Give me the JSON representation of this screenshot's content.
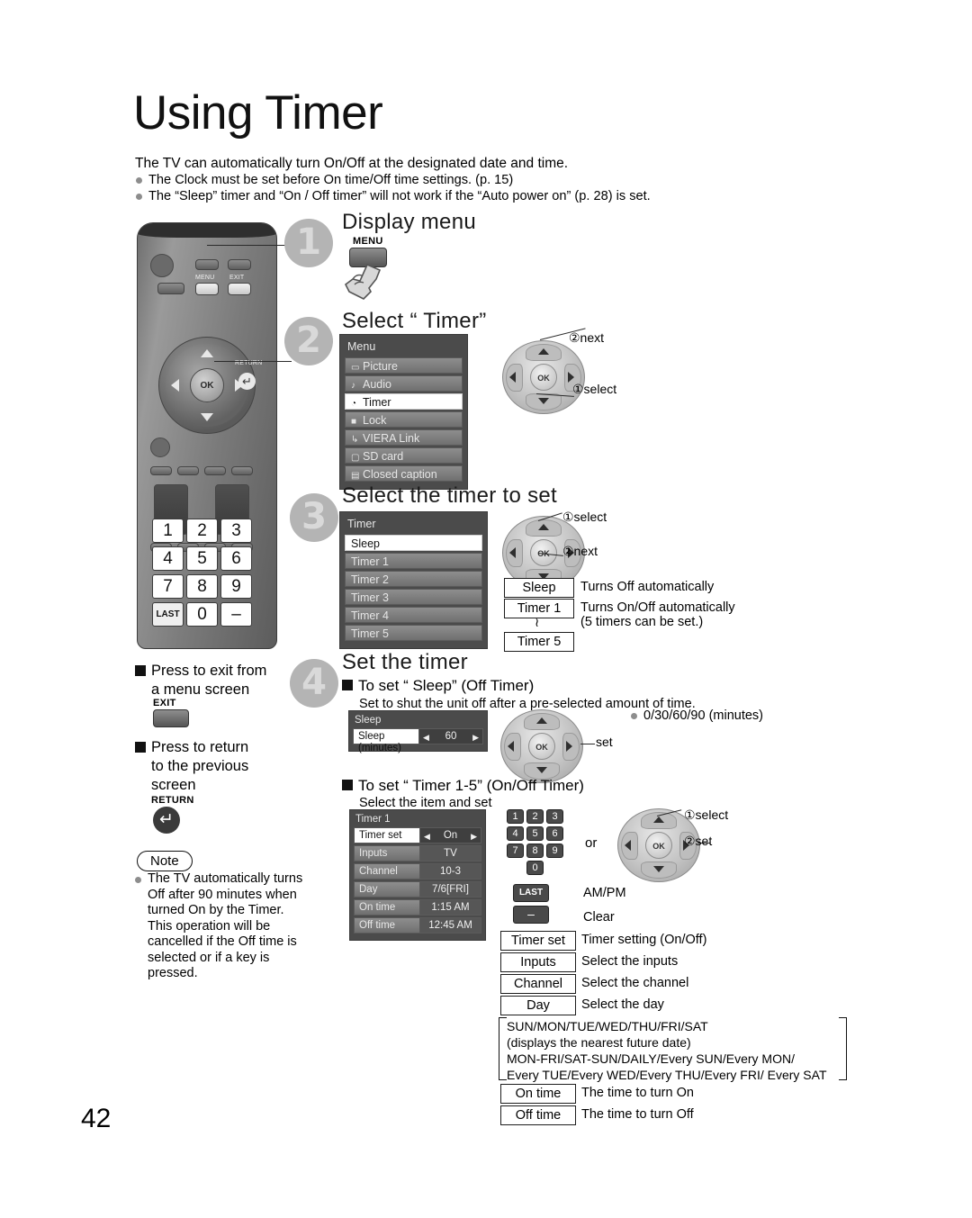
{
  "document": {
    "title": "Using Timer",
    "page_number": "42",
    "intro": "The TV can automatically turn On/Off at the designated date and time.",
    "intro_bullets": [
      "The Clock must be set before On time/Off time settings. (p. 15)",
      "The “Sleep” timer and “On / Off timer” will not work if the “Auto power on” (p. 28) is set."
    ]
  },
  "steps": {
    "one": {
      "number": "1",
      "title": "Display menu",
      "button_label": "MENU"
    },
    "two": {
      "number": "2",
      "title": "Select “ Timer”"
    },
    "three": {
      "number": "3",
      "title": "Select the timer to set"
    },
    "four": {
      "number": "4",
      "title": "Set the timer"
    }
  },
  "menu_osd": {
    "title": "Menu",
    "items": [
      {
        "icon": "▭",
        "label": "Picture",
        "selected": false
      },
      {
        "icon": "♪",
        "label": "Audio",
        "selected": false
      },
      {
        "icon": "◔",
        "label": "Timer",
        "selected": true
      },
      {
        "icon": "■",
        "label": "Lock",
        "selected": false
      },
      {
        "icon": "↳",
        "label": "VIERA Link",
        "selected": false
      },
      {
        "icon": "▢",
        "label": "SD card",
        "selected": false
      },
      {
        "icon": "▤",
        "label": "Closed caption",
        "selected": false
      }
    ]
  },
  "timer_osd": {
    "title": "Timer",
    "items": [
      {
        "label": "Sleep",
        "selected": true
      },
      {
        "label": "Timer 1",
        "selected": false
      },
      {
        "label": "Timer 2",
        "selected": false
      },
      {
        "label": "Timer 3",
        "selected": false
      },
      {
        "label": "Timer 4",
        "selected": false
      },
      {
        "label": "Timer 5",
        "selected": false
      }
    ]
  },
  "sleep_osd": {
    "title": "Sleep",
    "row_key": "Sleep (minutes)",
    "row_value": "60",
    "arrow_left": "◀",
    "arrow_right": "▶"
  },
  "timer1_osd": {
    "title": "Timer 1",
    "rows": [
      {
        "key": "Timer set",
        "value": "On",
        "selected": true
      },
      {
        "key": "Inputs",
        "value": "TV",
        "selected": false
      },
      {
        "key": "Channel",
        "value": "10-3",
        "selected": false
      },
      {
        "key": "Day",
        "value": "7/6[FRI]",
        "selected": false
      },
      {
        "key": "On time",
        "value": "1:15 AM",
        "selected": false
      },
      {
        "key": "Off time",
        "value": "12:45 AM",
        "selected": false
      }
    ]
  },
  "navpads": {
    "step2": {
      "first": "①select",
      "second": "②next",
      "ok": "OK"
    },
    "step3": {
      "first": "①select",
      "second": "②next",
      "ok": "OK"
    },
    "sleep": {
      "set_label": "set",
      "ok": "OK"
    },
    "timer1": {
      "first": "①select",
      "second": "②set",
      "ok": "OK",
      "or_label": "or"
    }
  },
  "timer_legend": [
    {
      "key": "Sleep",
      "desc": "Turns Off automatically"
    },
    {
      "key": "Timer 1",
      "desc": "Turns On/Off automatically"
    },
    {
      "key": "≀",
      "desc": "(5 timers can be set.)"
    },
    {
      "key": "Timer 5",
      "desc": ""
    }
  ],
  "step4": {
    "sub1_title": "To set “ Sleep” (Off Timer)",
    "sub1_desc": "Set to shut the unit off after a pre-selected amount of time.",
    "sleep_options": "0/30/60/90 (minutes)",
    "sub2_title": "To set “ Timer 1-5” (On/Off Timer)",
    "sub2_desc": "Select the item and set"
  },
  "keypad_remote": {
    "rows": [
      [
        "1",
        "2",
        "3"
      ],
      [
        "4",
        "5",
        "6"
      ],
      [
        "7",
        "8",
        "9"
      ]
    ],
    "last_row": [
      "LAST",
      "0",
      "–"
    ]
  },
  "mini_keypad": {
    "rows": [
      [
        "1",
        "2",
        "3"
      ],
      [
        "4",
        "5",
        "6"
      ],
      [
        "7",
        "8",
        "9"
      ]
    ],
    "zero": "0",
    "last_key": "LAST",
    "last_desc": "AM/PM",
    "dash_key": "–",
    "dash_desc": "Clear"
  },
  "item_legend": [
    {
      "key": "Timer set",
      "desc": "Timer setting (On/Off)"
    },
    {
      "key": "Inputs",
      "desc": "Select the inputs"
    },
    {
      "key": "Channel",
      "desc": "Select the channel"
    },
    {
      "key": "Day",
      "desc": "Select the day"
    }
  ],
  "day_options": [
    "SUN/MON/TUE/WED/THU/FRI/SAT",
    "(displays the nearest future date)",
    "MON-FRI/SAT-SUN/DAILY/Every SUN/Every MON/",
    "Every TUE/Every WED/Every THU/Every FRI/ Every SAT"
  ],
  "time_legend": [
    {
      "key": "On time",
      "desc": "The time to turn On"
    },
    {
      "key": "Off time",
      "desc": "The time to turn Off"
    }
  ],
  "left_column": {
    "exit_instruction_l1": "Press to exit from",
    "exit_instruction_l2": "a menu screen",
    "exit_key_label": "EXIT",
    "return_instruction_l1": "Press to return",
    "return_instruction_l2": "to the previous",
    "return_instruction_l3": "screen",
    "return_key_label": "RETURN",
    "note_label": "Note",
    "note_text": "The TV automatically turns Off after 90 minutes when turned On by the Timer. This operation will be cancelled if the Off time is selected or if a key is pressed."
  },
  "remote_labels": {
    "menu": "MENU",
    "exit": "EXIT",
    "return": "RETURN",
    "ok": "OK"
  }
}
